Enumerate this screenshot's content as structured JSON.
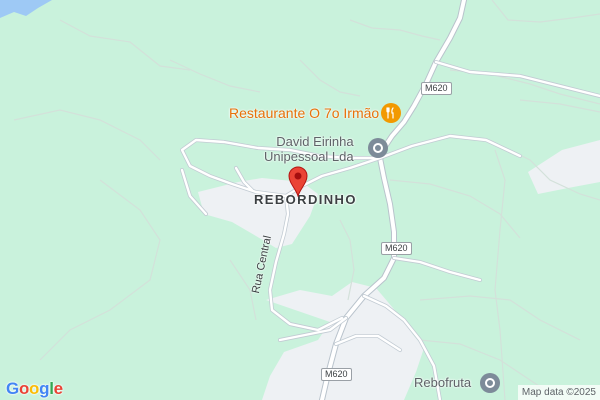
{
  "map": {
    "place": "REBORDINHO",
    "pois": {
      "restaurant": "Restaurante O 7o Irmão",
      "business_line1": "David Eirinha",
      "business_line2": "Unipessoal Lda",
      "rebofruta": "Rebofruta"
    },
    "street": "Rua Central",
    "route_shields": [
      "M620",
      "M620",
      "M620"
    ],
    "attribution": "Map data ©2025",
    "logo": [
      "G",
      "o",
      "o",
      "g",
      "l",
      "e"
    ],
    "colors": {
      "terrain": "#c9f2dc",
      "settlement": "#eef1f4",
      "road": "#ffffff",
      "road_outline": "#b9c3cc",
      "river": "#9ec9f5",
      "pin": "#ea4335",
      "restaurant_icon": "#f29900",
      "poi_icon": "#7d8b99"
    },
    "logo_colors": [
      "#4285f4",
      "#ea4335",
      "#fbbc05",
      "#4285f4",
      "#34a853",
      "#ea4335"
    ]
  }
}
